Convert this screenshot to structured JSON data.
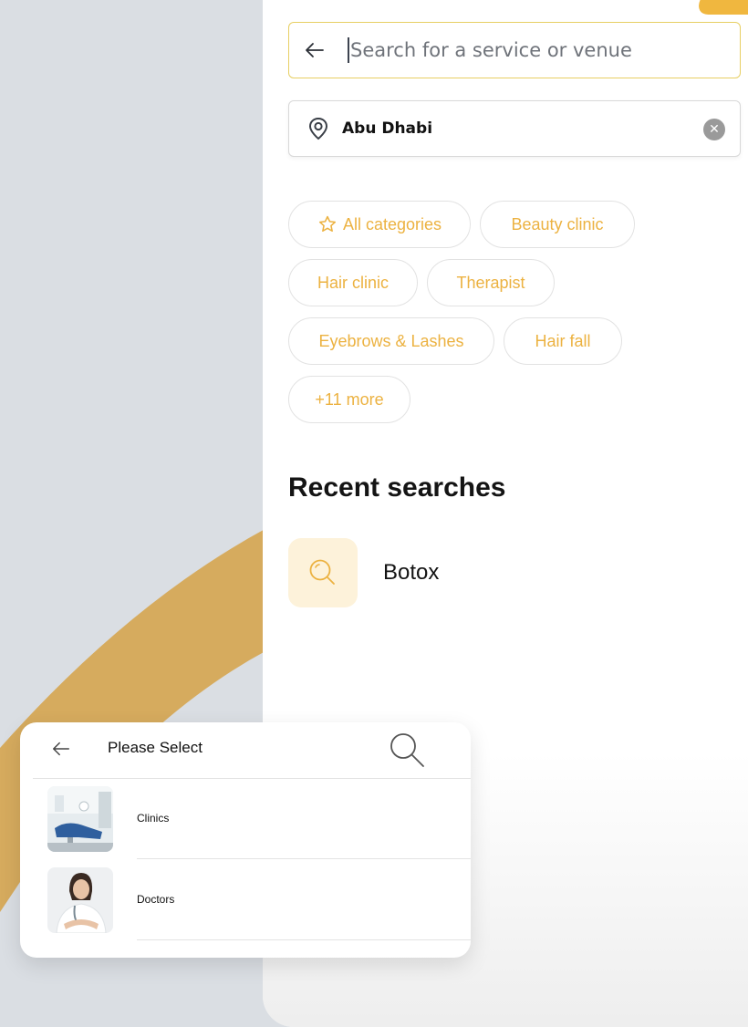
{
  "search": {
    "placeholder": "Search for a service or venue"
  },
  "location": {
    "value": "Abu Dhabi"
  },
  "categories": {
    "chips": [
      "All categories",
      "Beauty clinic",
      "Hair clinic",
      "Therapist",
      "Eyebrows & Lashes",
      "Hair fall",
      "+11 more"
    ]
  },
  "recent": {
    "title": "Recent searches",
    "items": [
      "Botox"
    ]
  },
  "selector": {
    "title": "Please Select",
    "options": [
      "Clinics",
      "Doctors"
    ]
  },
  "colors": {
    "accent": "#ecb241",
    "arc": "#d6ab5e",
    "background": "#dadee3"
  }
}
